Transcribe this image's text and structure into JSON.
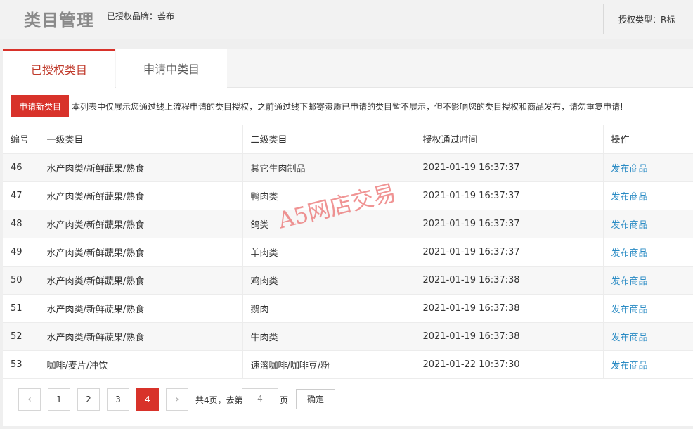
{
  "header": {
    "title": "类目管理",
    "brand_label": "已授权品牌：荟布",
    "auth_type_label": "授权类型：R标"
  },
  "tabs": [
    {
      "label": "已授权类目",
      "active": true
    },
    {
      "label": "申请中类目",
      "active": false
    }
  ],
  "notice": {
    "button_label": "申请新类目",
    "text": "本列表中仅展示您通过线上流程申请的类目授权，之前通过线下邮寄资质已申请的类目暂不展示，但不影响您的类目授权和商品发布，请勿重复申请!"
  },
  "table": {
    "headers": [
      "编号",
      "一级类目",
      "二级类目",
      "授权通过时间",
      "操作"
    ],
    "rows": [
      [
        "46",
        "水产肉类/新鲜蔬果/熟食",
        "其它生肉制品",
        "2021-01-19 16:37:37",
        "发布商品"
      ],
      [
        "47",
        "水产肉类/新鲜蔬果/熟食",
        "鸭肉类",
        "2021-01-19 16:37:37",
        "发布商品"
      ],
      [
        "48",
        "水产肉类/新鲜蔬果/熟食",
        "鸽类",
        "2021-01-19 16:37:37",
        "发布商品"
      ],
      [
        "49",
        "水产肉类/新鲜蔬果/熟食",
        "羊肉类",
        "2021-01-19 16:37:37",
        "发布商品"
      ],
      [
        "50",
        "水产肉类/新鲜蔬果/熟食",
        "鸡肉类",
        "2021-01-19 16:37:38",
        "发布商品"
      ],
      [
        "51",
        "水产肉类/新鲜蔬果/熟食",
        "鹅肉",
        "2021-01-19 16:37:38",
        "发布商品"
      ],
      [
        "52",
        "水产肉类/新鲜蔬果/熟食",
        "牛肉类",
        "2021-01-19 16:37:38",
        "发布商品"
      ],
      [
        "53",
        "咖啡/麦片/冲饮",
        "速溶咖啡/咖啡豆/粉",
        "2021-01-22 10:37:30",
        "发布商品"
      ]
    ]
  },
  "pagination": {
    "prev": "‹",
    "next": "›",
    "pages": [
      "1",
      "2",
      "3",
      "4"
    ],
    "current": "4",
    "total_text": "共4页，去第",
    "page_suffix": "页",
    "input_value": "4",
    "confirm_label": "确定"
  },
  "watermark": "A5网店交易",
  "colors": {
    "accent": "#d8322a",
    "link": "#2a8bc4"
  }
}
